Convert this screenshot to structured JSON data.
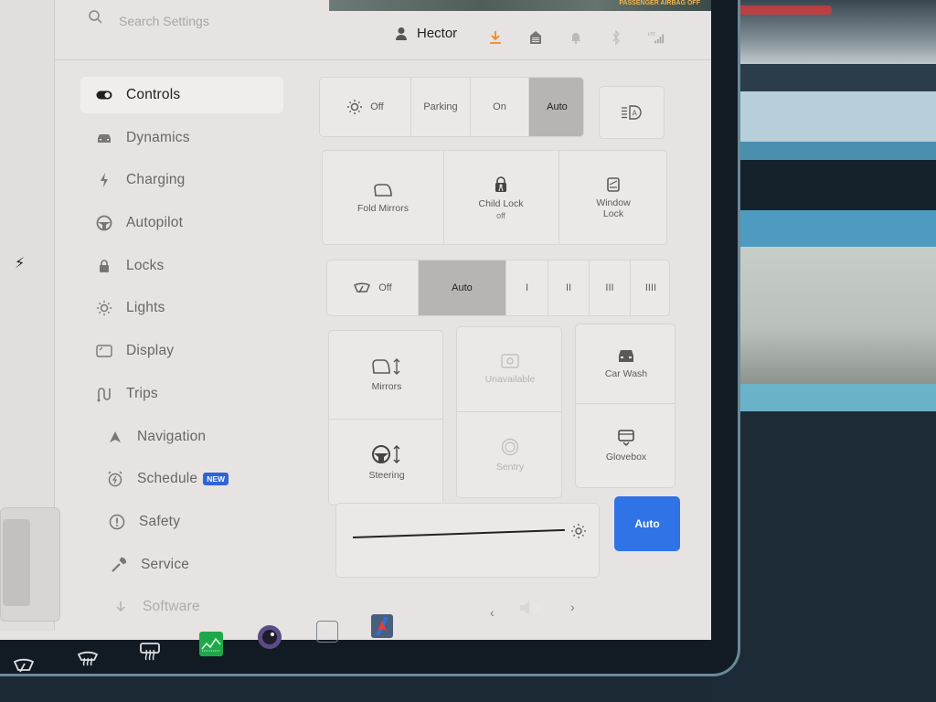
{
  "search": {
    "placeholder": "Search Settings"
  },
  "header": {
    "user_name": "Hector",
    "airbag_label": "PASSENGER AIRBAG OFF",
    "status_icons": [
      "download-icon",
      "garage-icon",
      "bell-icon",
      "bluetooth-icon",
      "lte-signal-icon"
    ],
    "signal_label": "LTE"
  },
  "sidebar": {
    "items": [
      {
        "label": "Controls",
        "icon": "toggle-icon",
        "active": true
      },
      {
        "label": "Dynamics",
        "icon": "car-icon"
      },
      {
        "label": "Charging",
        "icon": "bolt-icon"
      },
      {
        "label": "Autopilot",
        "icon": "steering-wheel-icon"
      },
      {
        "label": "Locks",
        "icon": "lock-icon"
      },
      {
        "label": "Lights",
        "icon": "sun-icon"
      },
      {
        "label": "Display",
        "icon": "display-icon"
      },
      {
        "label": "Trips",
        "icon": "trips-icon"
      },
      {
        "label": "Navigation",
        "icon": "navigation-arrow-icon"
      },
      {
        "label": "Schedule",
        "icon": "alarm-icon",
        "badge": "NEW"
      },
      {
        "label": "Safety",
        "icon": "exclamation-circle-icon"
      },
      {
        "label": "Service",
        "icon": "wrench-icon"
      },
      {
        "label": "Software",
        "icon": "download-icon"
      }
    ]
  },
  "headlights": {
    "options": [
      "Off",
      "Parking",
      "On",
      "Auto"
    ],
    "selected": "Auto",
    "auto_high_beam_icon": "auto-high-beam-icon"
  },
  "quick_toggles": [
    {
      "label": "Fold Mirrors",
      "icon": "mirror-icon"
    },
    {
      "label": "Child Lock",
      "sub": "off",
      "icon": "child-lock-icon"
    },
    {
      "label": "Window Lock",
      "icon": "window-lock-icon"
    }
  ],
  "wipers": {
    "options": [
      "Off",
      "Auto",
      "I",
      "II",
      "III",
      "IIII"
    ],
    "selected": "Auto"
  },
  "adjust_tiles": [
    {
      "label": "Mirrors",
      "icon": "mirror-adjust-icon"
    },
    {
      "label": "Steering",
      "icon": "steering-adjust-icon"
    },
    {
      "label": "Unavailable",
      "icon": "camera-icon",
      "disabled": true
    },
    {
      "label": "Sentry",
      "icon": "sentry-icon",
      "disabled": true
    },
    {
      "label": "Car Wash",
      "icon": "car-wash-icon"
    },
    {
      "label": "Glovebox",
      "icon": "glovebox-icon"
    }
  ],
  "brightness": {
    "value_fraction": 1.0,
    "auto_label": "Auto"
  },
  "taskbar": {
    "items": [
      "front-wiper-icon",
      "front-defrost-icon",
      "rear-defrost-icon",
      "energy-app-icon",
      "camera-app-icon",
      "more-apps-icon",
      "navigation-app-icon"
    ],
    "volume_state": "muted"
  }
}
